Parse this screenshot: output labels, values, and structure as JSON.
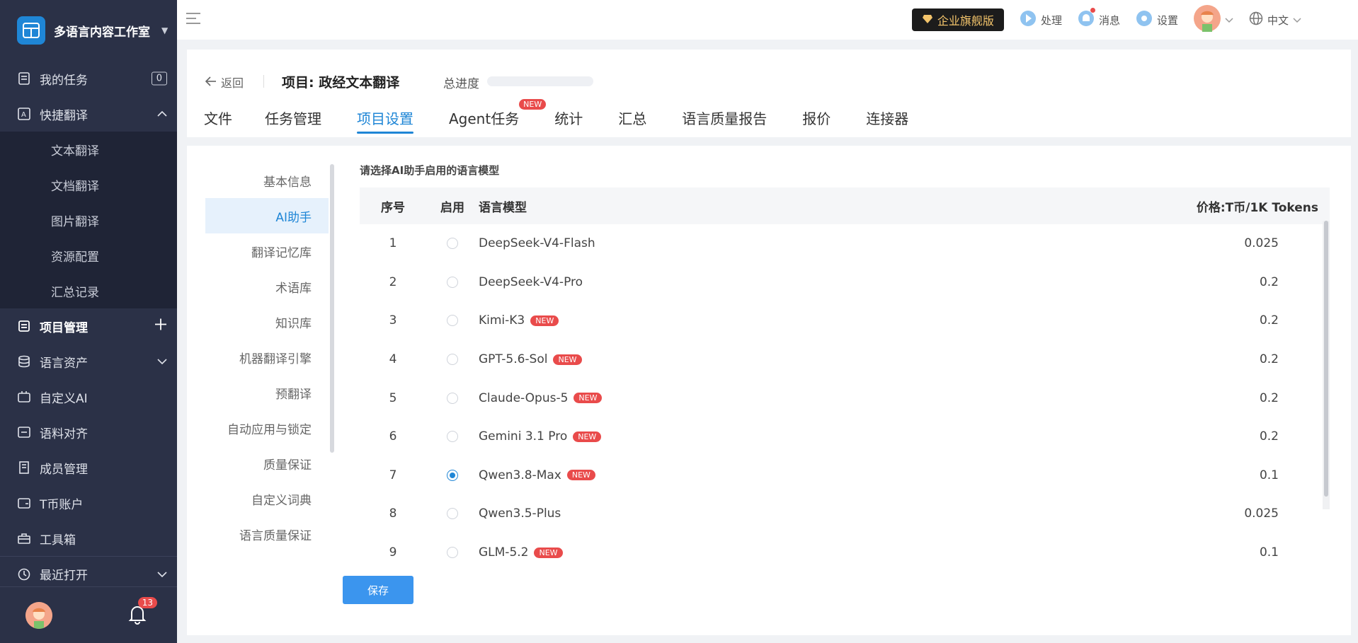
{
  "sidebar": {
    "brand": "多语言内容工作室",
    "items": [
      {
        "label": "我的任务",
        "badge": "0"
      },
      {
        "label": "快捷翻译"
      }
    ],
    "quick_sub": [
      "文本翻译",
      "文档翻译",
      "图片翻译",
      "资源配置",
      "汇总记录"
    ],
    "lower": [
      {
        "label": "项目管理"
      },
      {
        "label": "语言资产"
      },
      {
        "label": "自定义AI"
      },
      {
        "label": "语料对齐"
      },
      {
        "label": "成员管理"
      },
      {
        "label": "T币账户"
      },
      {
        "label": "工具箱"
      },
      {
        "label": "最近打开"
      }
    ],
    "notification_count": "13"
  },
  "topbar": {
    "vip_label": "企业旗舰版",
    "process": "处理",
    "messages": "消息",
    "settings": "设置",
    "language": "中文"
  },
  "project": {
    "back": "返回",
    "title": "项目: 政经文本翻译",
    "progress_label": "总进度",
    "progress": 0,
    "tabs": [
      "文件",
      "任务管理",
      "项目设置",
      "Agent任务",
      "统计",
      "汇总",
      "语言质量报告",
      "报价",
      "连接器"
    ],
    "tab_new": "NEW"
  },
  "settings_nav": [
    "基本信息",
    "AI助手",
    "翻译记忆库",
    "术语库",
    "知识库",
    "机器翻译引擎",
    "预翻译",
    "自动应用与锁定",
    "质量保证",
    "自定义词典",
    "语言质量保证"
  ],
  "table": {
    "title": "请选择AI助手启用的语言模型",
    "headers": [
      "序号",
      "启用",
      "语言模型",
      "价格:T币/1K Tokens"
    ],
    "new_label": "NEW",
    "rows": [
      {
        "no": "1",
        "model": "DeepSeek-V4-Flash",
        "price": "0.025"
      },
      {
        "no": "2",
        "model": "DeepSeek-V4-Pro",
        "price": "0.2"
      },
      {
        "no": "3",
        "model": "Kimi-K3",
        "price": "0.2"
      },
      {
        "no": "4",
        "model": "GPT-5.6-Sol",
        "price": "0.2"
      },
      {
        "no": "5",
        "model": "Claude-Opus-5",
        "price": "0.2"
      },
      {
        "no": "6",
        "model": "Gemini 3.1 Pro",
        "price": "0.2"
      },
      {
        "no": "7",
        "model": "Qwen3.8-Max",
        "price": "0.1"
      },
      {
        "no": "8",
        "model": "Qwen3.5-Plus",
        "price": "0.025"
      },
      {
        "no": "9",
        "model": "GLM-5.2",
        "price": "0.1"
      }
    ]
  },
  "save_label": "保存"
}
